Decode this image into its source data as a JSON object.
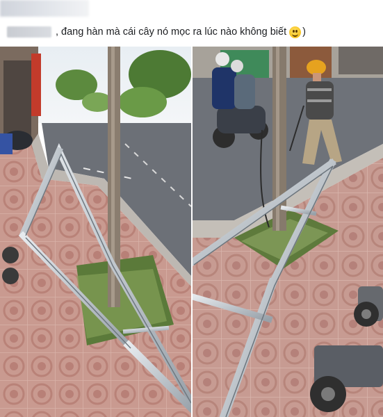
{
  "post": {
    "caption_text": ", đang hàn mà cái cây nó mọc ra lúc nào không biết",
    "caption_end": ")",
    "emoji_icon": "smiling-face-emoji"
  },
  "colors": {
    "link_blue": "#3b5998",
    "tile_red": "#c9978d",
    "steel": "#b8c0c7",
    "road": "#6d7178"
  }
}
